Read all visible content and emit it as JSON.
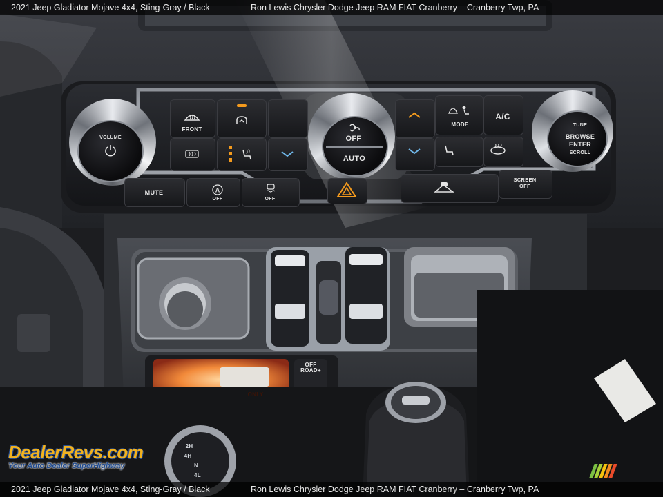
{
  "caption": {
    "left": "2021 Jeep Gladiator Mojave 4x4,  Sting-Gray / Black",
    "right": "Ron Lewis Chrysler Dodge Jeep RAM FIAT Cranberry – Cranberry Twp, PA"
  },
  "climate_panel": {
    "volume_knob": "VOLUME",
    "front_button": "FRONT",
    "mode_button": "MODE",
    "ac_button": "A/C",
    "off_label": "OFF",
    "auto_label": "AUTO",
    "tune_knob": [
      "TUNE",
      "BROWSE",
      "ENTER",
      "SCROLL"
    ],
    "mute_button": "MUTE",
    "auto_stop_off": "OFF",
    "traction_off": "OFF",
    "screen_off": [
      "SCREEN",
      "OFF"
    ]
  },
  "console": {
    "offroad_button": [
      "OFF",
      "ROAD+"
    ],
    "usb_label": "ONLY"
  },
  "shifter": {
    "gear_labels": [
      "2H",
      "4H",
      "N",
      "4L"
    ]
  },
  "watermark": {
    "brand": "DealerRevs.com",
    "tagline": "Your Auto Dealer SuperHighway",
    "stripe_colors": [
      "#7bc043",
      "#a5d03a",
      "#f4c20d",
      "#f28c1e",
      "#e94b2a"
    ]
  },
  "colors": {
    "accent_orange": "#f39a1d",
    "panel_dark": "#18191c",
    "chrome": "#c9cdd3"
  }
}
